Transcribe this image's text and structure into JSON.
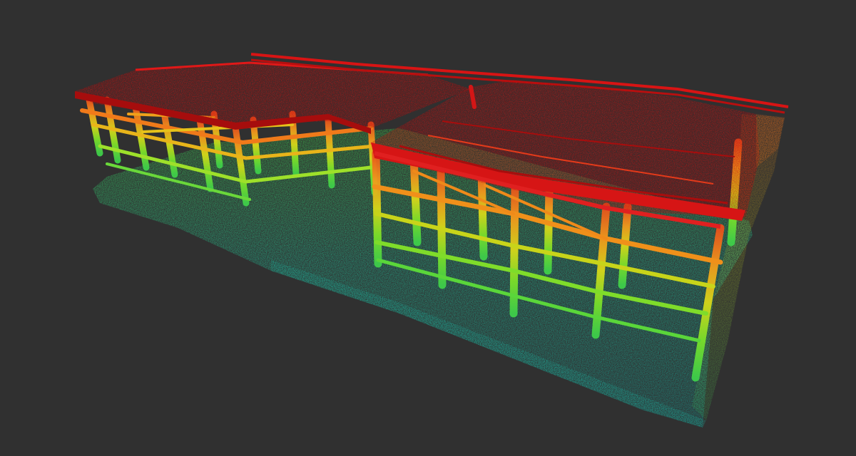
{
  "viewer": {
    "background_color": "#303030",
    "content": "point-cloud",
    "color_mode": "height-colormap",
    "colormap": [
      "#1aa3a3",
      "#22c49a",
      "#3fd14a",
      "#8fe32a",
      "#e0d21a",
      "#f29a1c",
      "#e8501c",
      "#d41616",
      "#b80f0f"
    ]
  }
}
